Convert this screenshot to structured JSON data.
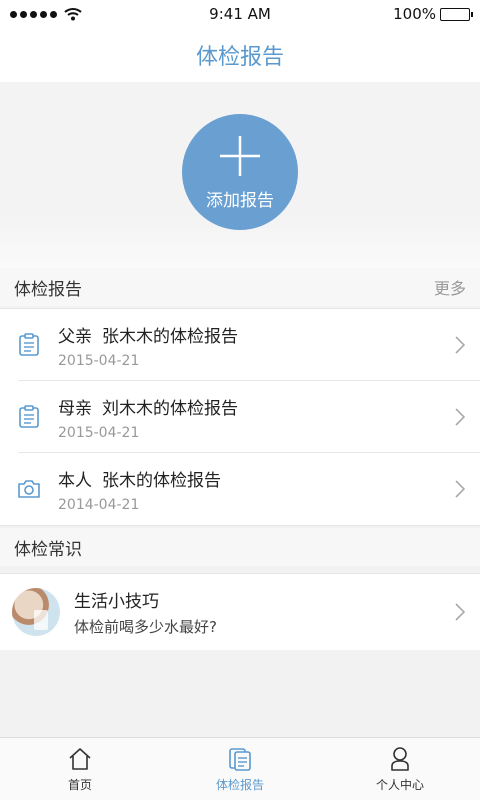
{
  "status_bar": {
    "time": "9:41 AM",
    "battery": "100%"
  },
  "nav": {
    "title": "体检报告"
  },
  "hero": {
    "add_label": "添加报告"
  },
  "reports_section": {
    "title": "体检报告",
    "more": "更多",
    "items": [
      {
        "relation": "父亲",
        "name": "张木木的体检报告",
        "date": "2015-04-21",
        "icon": "clipboard-icon"
      },
      {
        "relation": "母亲",
        "name": "刘木木的体检报告",
        "date": "2015-04-21",
        "icon": "clipboard-icon"
      },
      {
        "relation": "本人",
        "name": "张木的体检报告",
        "date": "2014-04-21",
        "icon": "camera-icon"
      }
    ]
  },
  "knowledge_section": {
    "title": "体检常识",
    "item": {
      "title": "生活小技巧",
      "subtitle": "体检前喝多少水最好?"
    }
  },
  "tab_bar": {
    "tabs": [
      {
        "label": "首页",
        "icon": "home-icon"
      },
      {
        "label": "体检报告",
        "icon": "document-icon",
        "active": true
      },
      {
        "label": "个人中心",
        "icon": "user-icon"
      }
    ]
  },
  "colors": {
    "accent": "#5a99cf",
    "add_button": "#6a9fd2"
  }
}
